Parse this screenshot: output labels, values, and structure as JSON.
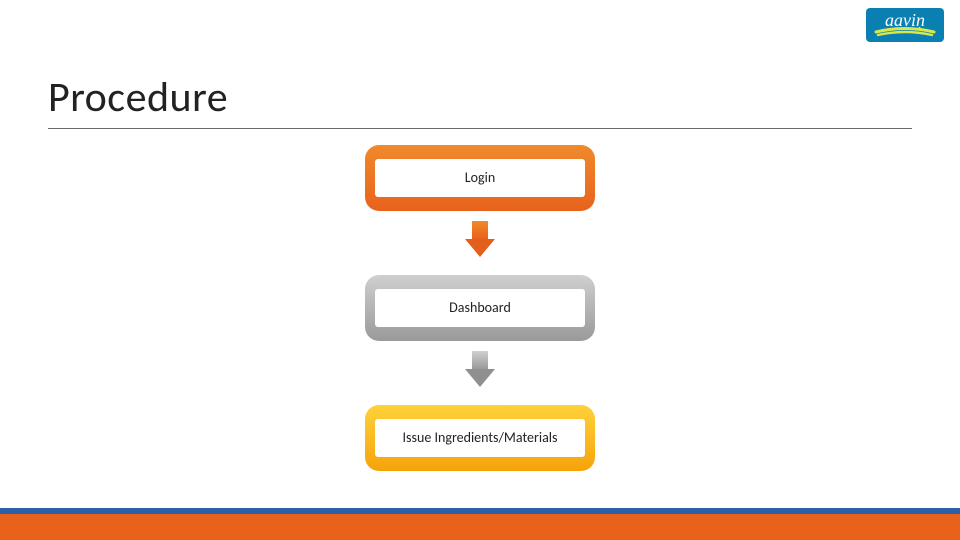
{
  "title": "Procedure",
  "logo": {
    "text": "aaviṇ",
    "bg": "#0a7fb2"
  },
  "flow": {
    "steps": [
      {
        "label": "Login",
        "color": "orange"
      },
      {
        "label": "Dashboard",
        "color": "gray"
      },
      {
        "label": "Issue Ingredients/Materials",
        "color": "yellow"
      }
    ],
    "arrows": [
      {
        "color": "orange"
      },
      {
        "color": "gray"
      }
    ]
  },
  "footer": {
    "thin_color": "#2e5fa5",
    "thick_color": "#e8621c"
  }
}
